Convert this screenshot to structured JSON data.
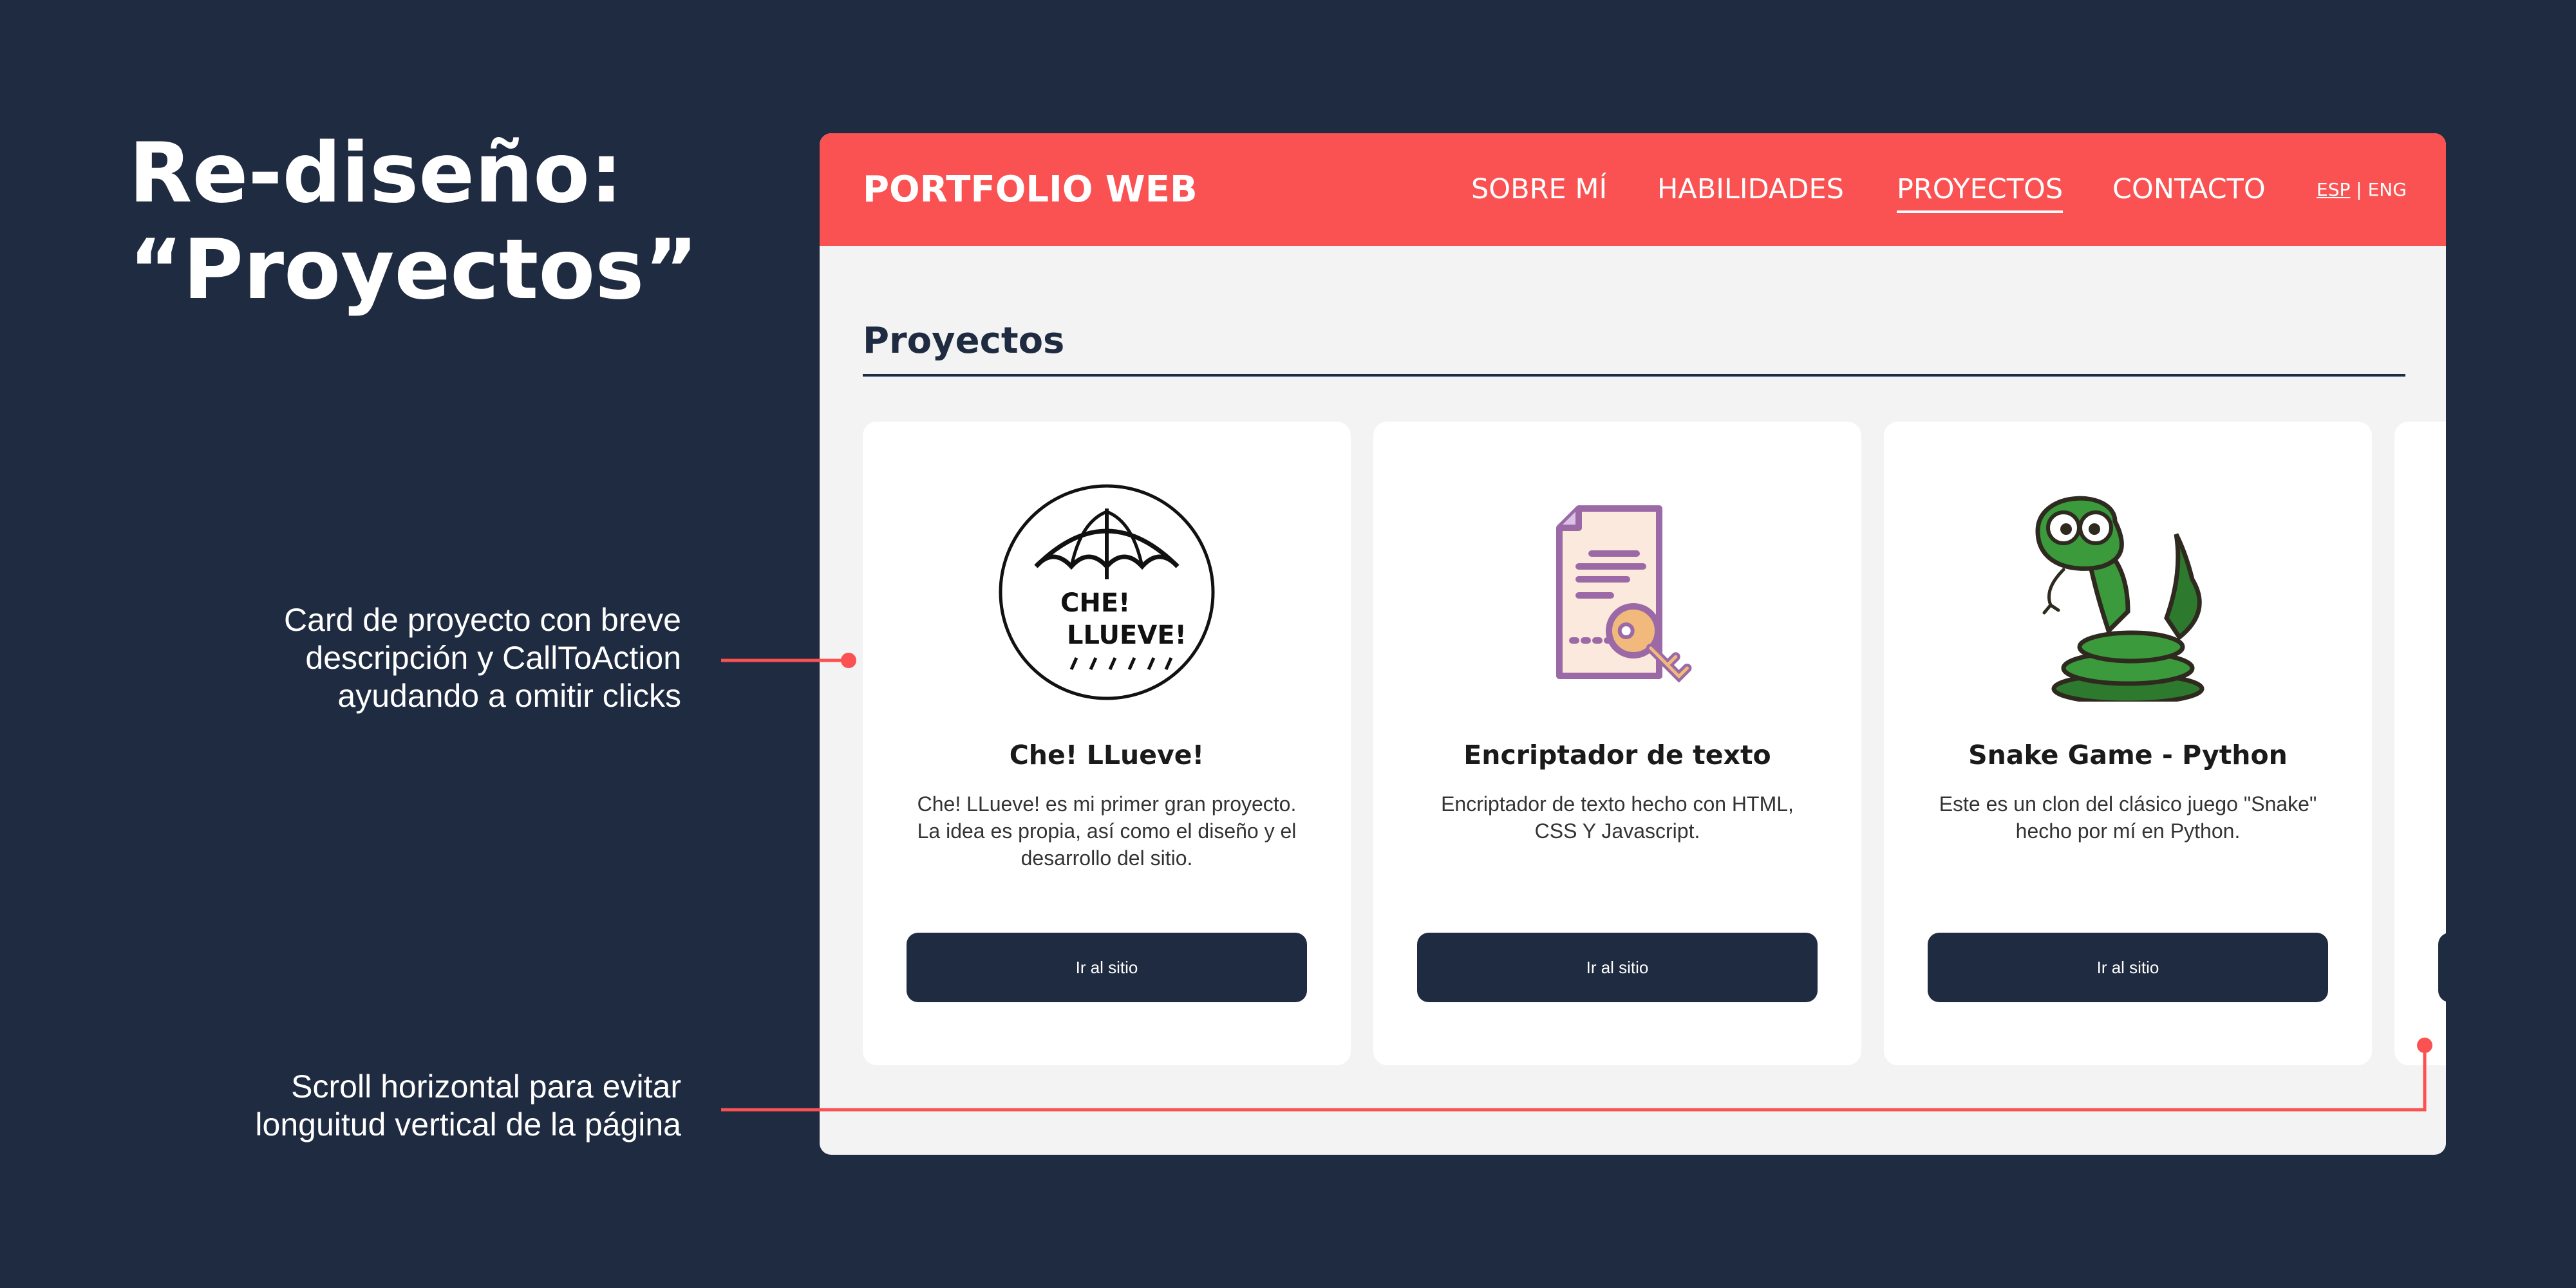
{
  "slide": {
    "title_line1": "Re-diseño:",
    "title_line2": "“Proyectos”",
    "annotation_card": [
      "Card de proyecto con breve",
      "descripción y CallToAction",
      "ayudando a omitir clicks"
    ],
    "annotation_scroll": [
      "Scroll horizontal para evitar",
      "longuitud vertical de la página"
    ],
    "accent_color": "#fa5252",
    "background_color": "#1f2b40"
  },
  "site": {
    "brand": "PORTFOLIO WEB",
    "nav": [
      "SOBRE MÍ",
      "HABILIDADES",
      "PROYECTOS",
      "CONTACTO"
    ],
    "active_nav": "PROYECTOS",
    "lang": {
      "esp": "ESP",
      "separator": "|",
      "eng": "ENG"
    },
    "section_title": "Proyectos"
  },
  "cards": [
    {
      "title": "Che! LLueve!",
      "description": "Che! LLueve! es mi primer gran proyecto. La idea es propia, así como el diseño y el desarrollo del sitio.",
      "button": "Ir al sitio",
      "icon": "umbrella-logo-icon",
      "logo_text_1": "CHE!",
      "logo_text_2": "LLUEVE!"
    },
    {
      "title": "Encriptador de texto",
      "description": "Encriptador de texto hecho con HTML, CSS Y Javascript.",
      "button": "Ir al sitio",
      "icon": "document-key-icon"
    },
    {
      "title": "Snake Game - Python",
      "description": "Este es un clon del clásico juego \"Snake\" hecho por mí en Python.",
      "button": "Ir al sitio",
      "icon": "snake-icon"
    }
  ]
}
